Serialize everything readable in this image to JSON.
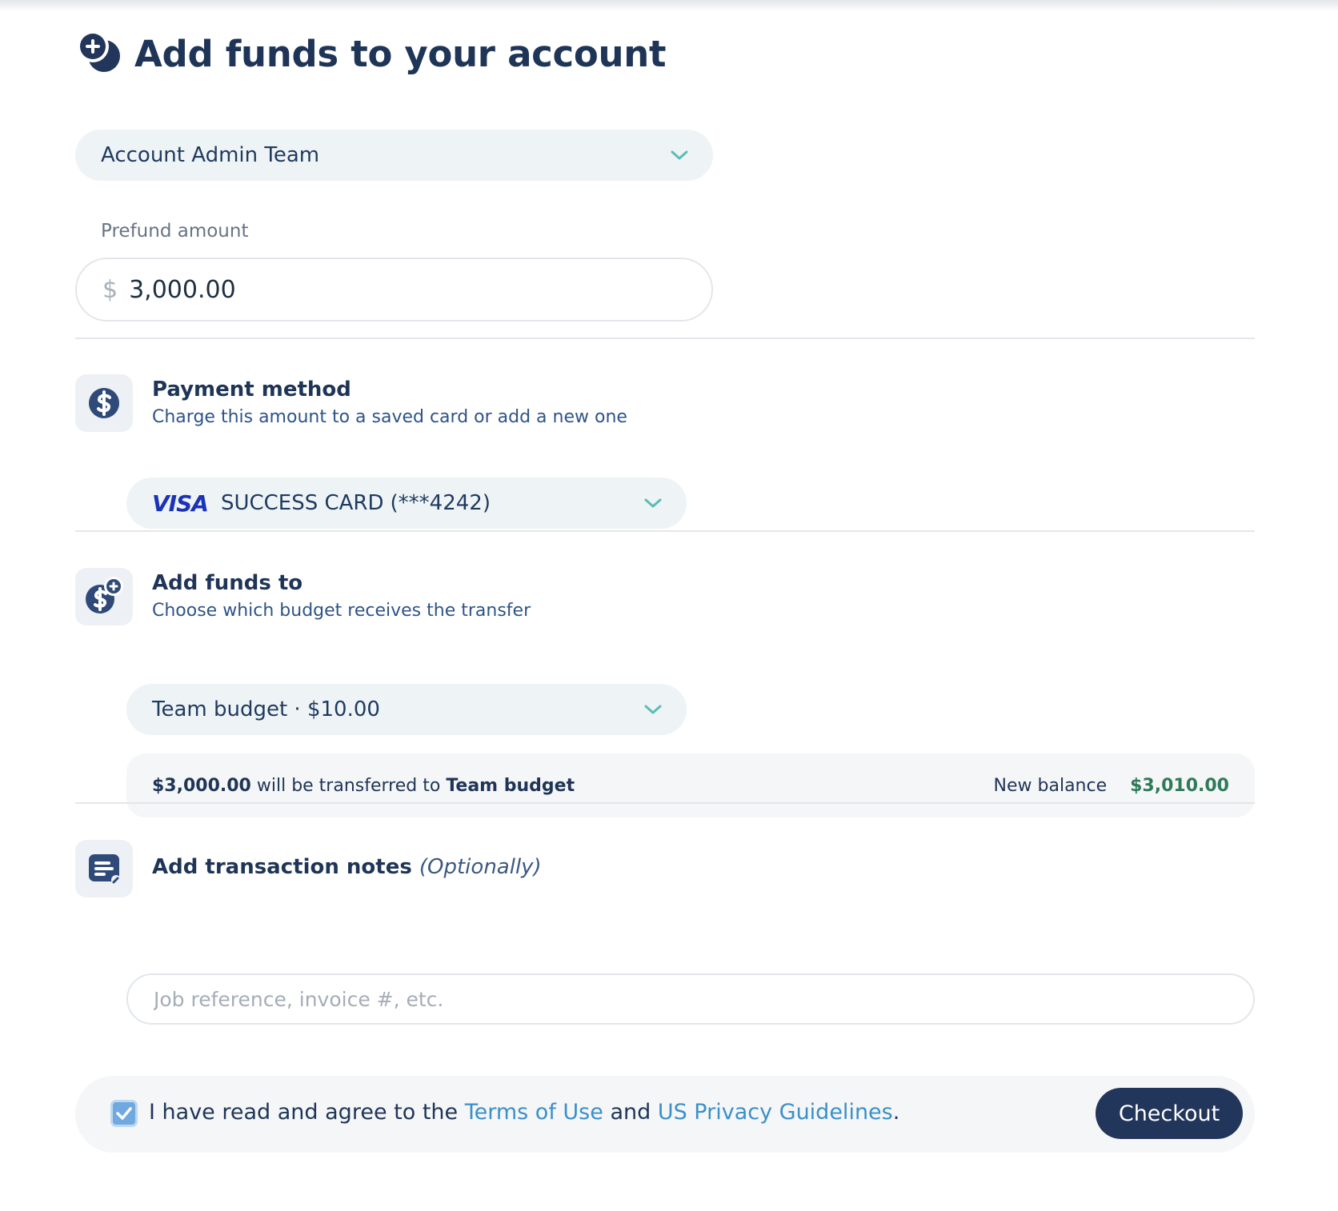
{
  "page": {
    "title": "Add funds to your account"
  },
  "team_select": {
    "value": "Account Admin Team"
  },
  "prefund": {
    "label": "Prefund amount",
    "currency_symbol": "$",
    "value": "3,000.00"
  },
  "payment_method": {
    "title": "Payment method",
    "subtitle": "Charge this amount to a saved card or add a new one",
    "card_brand": "VISA",
    "card_name": "SUCCESS CARD",
    "card_mask": "(***4242)"
  },
  "add_funds_to": {
    "title": "Add funds to",
    "subtitle": "Choose which budget receives the transfer",
    "selected": "Team budget · $10.00",
    "transfer_amount": "$3,000.00",
    "transfer_text": " will be transferred to ",
    "transfer_target": "Team budget",
    "new_balance_label": "New balance",
    "new_balance_value": "$3,010.00"
  },
  "notes": {
    "title": "Add transaction notes",
    "title_optional": "(Optionally)",
    "placeholder": "Job reference, invoice #, etc."
  },
  "agreement": {
    "checked": true,
    "text_before": "I have read and agree to the ",
    "terms_link": "Terms of Use",
    "text_middle": " and ",
    "privacy_link": "US Privacy Guidelines",
    "text_after": "."
  },
  "checkout_label": "Checkout",
  "colors": {
    "primary_navy": "#22355a",
    "link_blue": "#3a90c9",
    "balance_green": "#2f7a57",
    "chevron_teal": "#5bbdb5",
    "visa_blue": "#1a33b7"
  },
  "icons": {
    "title": "add-funds-icon",
    "payment": "dollar-icon",
    "add_funds": "dollar-plus-icon",
    "notes": "notes-icon",
    "dropdown": "chevron-down-icon",
    "check": "checkmark-icon"
  }
}
